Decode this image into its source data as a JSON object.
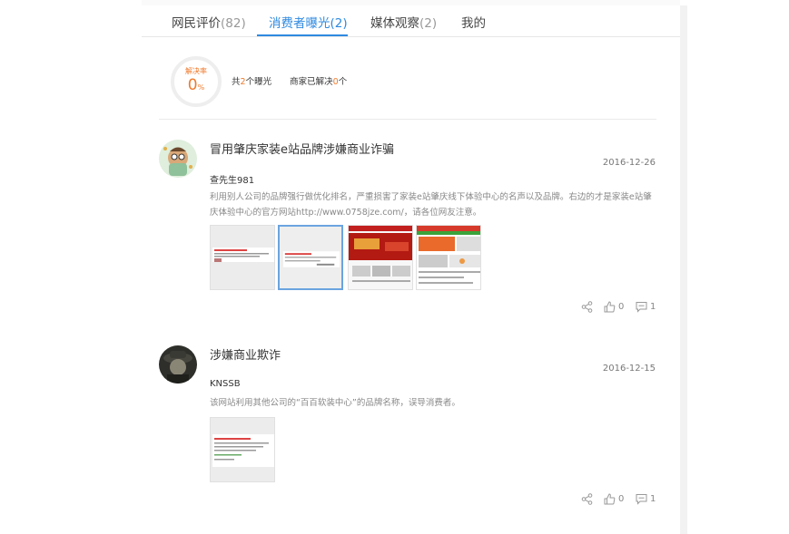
{
  "tabs": [
    {
      "label": "网民评价",
      "count": "(82)"
    },
    {
      "label": "消费者曝光",
      "count": "(2)"
    },
    {
      "label": "媒体观察",
      "count": "(2)"
    },
    {
      "label": "我的",
      "count": ""
    }
  ],
  "summary": {
    "rate_label": "解决率",
    "rate_value": "0",
    "rate_unit": "%",
    "total_prefix": "共",
    "total_count": "2",
    "total_suffix": "个曝光",
    "resolved_prefix": "商家已解决",
    "resolved_count": "0",
    "resolved_suffix": "个"
  },
  "posts": [
    {
      "title": "冒用肇庆家装e站品牌涉嫌商业诈骗",
      "date": "2016-12-26",
      "user": "查先生981",
      "body": "利用别人公司的品牌强行做优化排名，严重损害了家装e站肇庆线下体验中心的名声以及品牌。右边的才是家装e站肇庆体验中心的官方网站http://www.0758jze.com/，请各位网友注意。",
      "likes": "0",
      "comments": "1"
    },
    {
      "title": "涉嫌商业欺诈",
      "date": "2016-12-15",
      "user": "KNSSB",
      "body": "该网站利用其他公司的“百百软装中心”的品牌名称，误导消费者。",
      "likes": "0",
      "comments": "1"
    }
  ],
  "colors": {
    "accent": "#2f8ae0",
    "highlight": "#f07a2c"
  }
}
